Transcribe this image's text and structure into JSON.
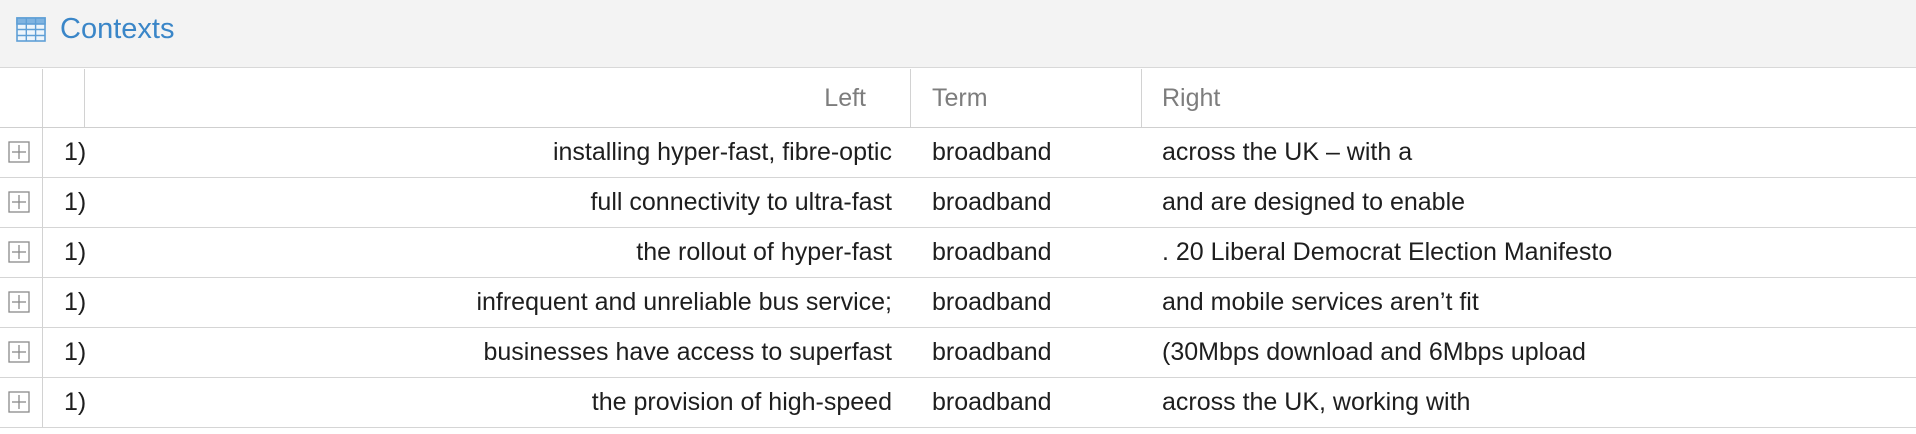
{
  "panel": {
    "title": "Contexts",
    "icon": "table-icon",
    "accent": "#3a86c8"
  },
  "columns": {
    "left": "Left",
    "term": "Term",
    "right": "Right"
  },
  "rows": [
    {
      "num": "1)",
      "left": "installing hyper-fast, fibre-optic",
      "term": "broadband",
      "right": "across the UK – with a"
    },
    {
      "num": "1)",
      "left": "full connectivity to ultra-fast",
      "term": "broadband",
      "right": "and are designed to enable"
    },
    {
      "num": "1)",
      "left": "the rollout of hyper-fast",
      "term": "broadband",
      "right": ". 20 Liberal Democrat Election Manifesto"
    },
    {
      "num": "1)",
      "left": "infrequent and unreliable bus service;",
      "term": "broadband",
      "right": "and mobile services aren’t fit"
    },
    {
      "num": "1)",
      "left": "businesses have access to superfast",
      "term": "broadband",
      "right": "(30Mbps download and 6Mbps upload"
    },
    {
      "num": "1)",
      "left": "the provision of high-speed",
      "term": "broadband",
      "right": "across the UK, working with"
    }
  ]
}
